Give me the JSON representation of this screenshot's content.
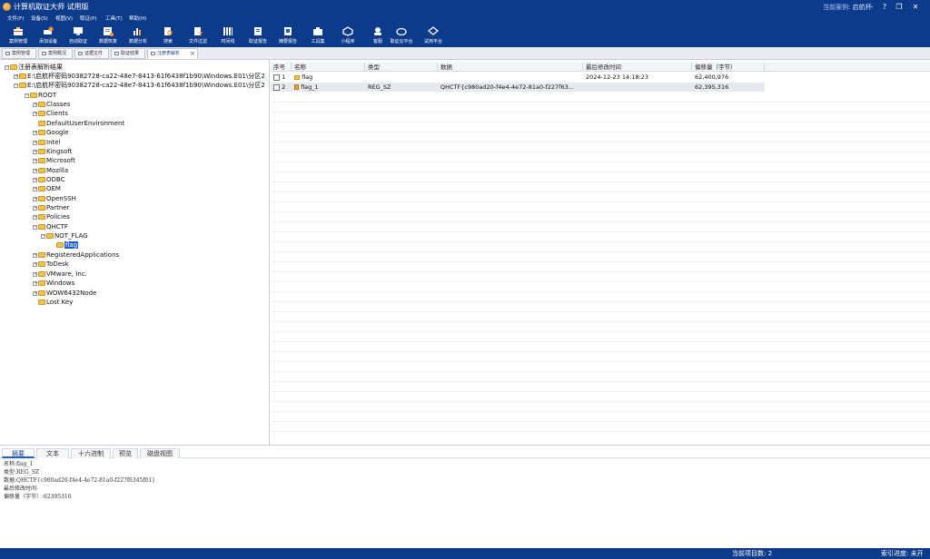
{
  "app": {
    "title": "计算机取证大师 试用版",
    "case_label": "当前案例:",
    "case_name": "启航杯",
    "window_controls": [
      "-",
      "?",
      "❐",
      "✕"
    ]
  },
  "menu": [
    "文件(F)",
    "设备(S)",
    "视图(V)",
    "取证(P)",
    "工具(T)",
    "帮助(H)"
  ],
  "toolbar": [
    {
      "label": "案例管理",
      "icon": "case-icon"
    },
    {
      "label": "添加设备",
      "icon": "add-device-icon"
    },
    {
      "label": "自动取证",
      "icon": "auto-forensic-icon"
    },
    {
      "label": "数据恢复",
      "icon": "data-recovery-icon"
    },
    {
      "label": "数据分析",
      "icon": "data-analysis-icon"
    },
    {
      "label": "搜索",
      "icon": "search-icon"
    },
    {
      "label": "文件过滤",
      "icon": "file-filter-icon"
    },
    {
      "label": "时间线",
      "icon": "timeline-icon"
    },
    {
      "label": "取证报告",
      "icon": "report-icon"
    },
    {
      "label": "摘要报告",
      "icon": "summary-report-icon"
    },
    {
      "label": "工具集",
      "icon": "toolset-icon"
    },
    {
      "label": "小程序",
      "icon": "miniprogram-icon"
    },
    {
      "label": "客服",
      "icon": "support-icon"
    },
    {
      "label": "取证云平台",
      "icon": "cloud-platform-icon"
    },
    {
      "label": "试用平台",
      "icon": "trial-platform-icon"
    }
  ],
  "tabs": [
    "案例管理",
    "案例概况",
    "证据文件",
    "取证结果",
    "注册表解析"
  ],
  "tree": {
    "root": "注册表解析结果",
    "hive1": "E:\\启航杯密码90382728-ca22-48e7-8413-61f6438f1b90\\Windows.E01\\分区2",
    "hive2": "E:\\启航杯密码90382728-ca22-48e7-8413-61f6438f1b90\\Windows.E01\\分区2",
    "ROOT": "ROOT",
    "keys": [
      "Classes",
      "Clients",
      "DefaultUserEnvironment",
      "Google",
      "Intel",
      "Kingsoft",
      "Microsoft",
      "Mozilla",
      "ODBC",
      "OEM",
      "OpenSSH",
      "Partner",
      "Policies",
      "QHCTF"
    ],
    "qhctf_child": "NOT_FLAG",
    "selected": "flag",
    "keys_after": [
      "RegisteredApplications",
      "ToDesk",
      "VMware, Inc.",
      "Windows",
      "WOW6432Node",
      "Lost Key"
    ]
  },
  "grid": {
    "headers": [
      "序号",
      "名称",
      "类型",
      "数据",
      "最后修改时间",
      "偏移量（字节）"
    ],
    "rows": [
      {
        "no": "1",
        "name": "flag",
        "type": "",
        "data": "",
        "mtime": "2024-12-23 14:18:23",
        "offset": "62,400,976"
      },
      {
        "no": "2",
        "name": "flag_1",
        "type": "REG_SZ",
        "data": "QHCTF{c980ad20-f4e4-4e72-81a0-f227f63...",
        "mtime": "",
        "offset": "62,395,316"
      }
    ]
  },
  "bottom_tabs": [
    "摘要",
    "文本",
    "十六进制",
    "预览",
    "磁盘视图"
  ],
  "detail": {
    "name": "名称:flag_1",
    "type": "类型:REG_SZ",
    "data": "数据:QHCTF{c980ad20-f4e4-4e72-81a0-f227f6345f01}",
    "mtime": "最后修改时间:",
    "offset": "偏移量（字节）:62395316"
  },
  "status": {
    "count": "当前项目数: 2",
    "index": "索引进度: 未开"
  },
  "colors": {
    "chrome_blue": "#0d3b8c",
    "selection_blue": "#1f5fd0",
    "folder_yellow": "#f3c24a"
  }
}
